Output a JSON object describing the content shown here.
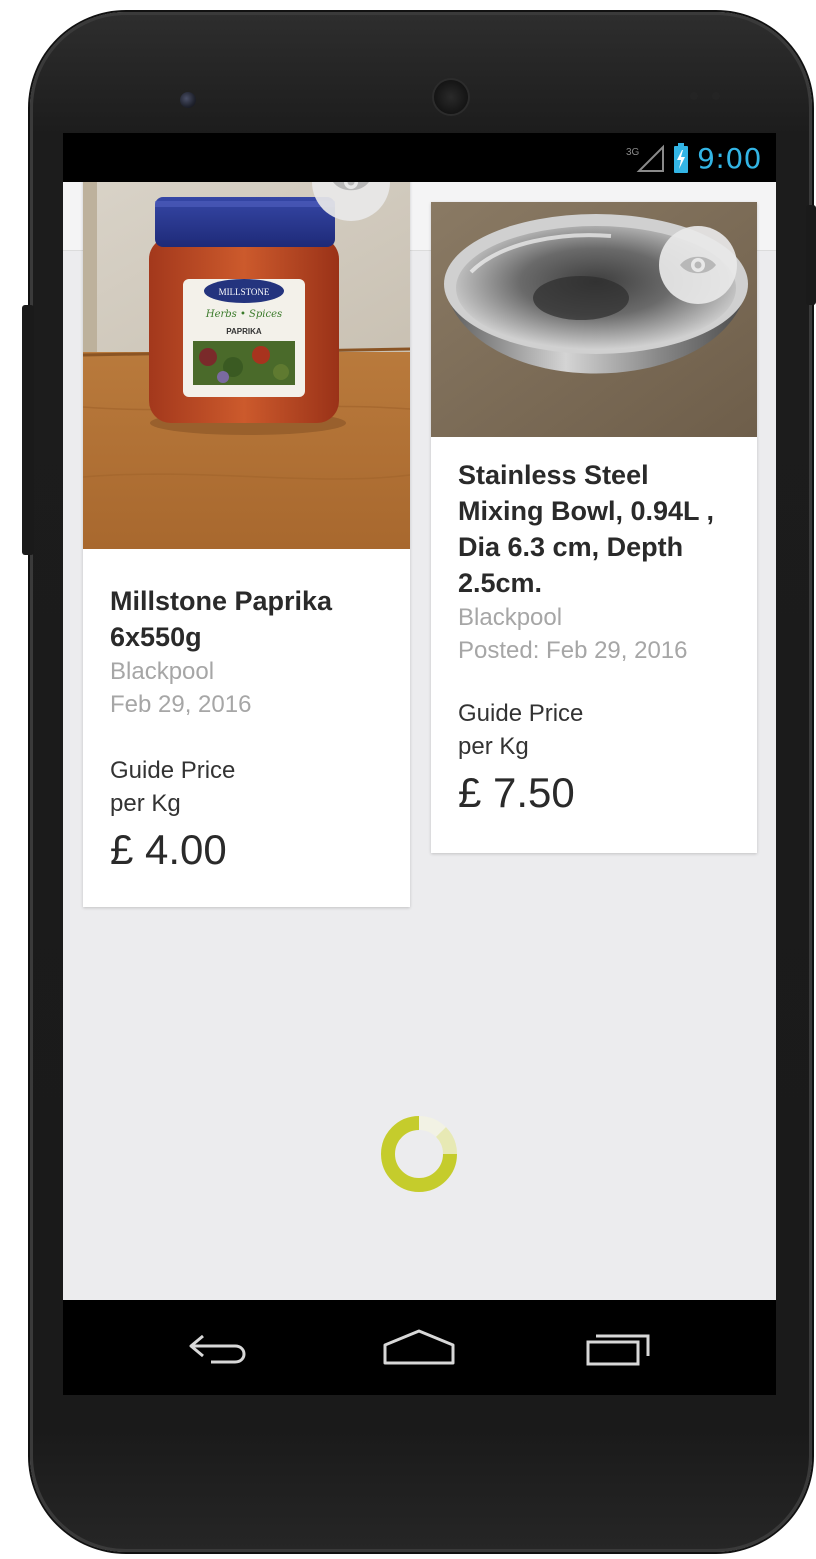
{
  "status_bar": {
    "network_label": "3G",
    "time": "9:00",
    "accent_color": "#33b5e5"
  },
  "listings": [
    {
      "title": "Millstone Paprika 6x550g",
      "location": "Blackpool",
      "date": "Feb 29, 2016",
      "guide_label_line1": "Guide Price",
      "guide_label_line2": "per Kg",
      "price": "£ 4.00",
      "image_label": "Paprika jar photo",
      "jar_brand": "MILLSTONE",
      "jar_subtitle": "Herbs • Spices",
      "jar_product": "PAPRIKA"
    },
    {
      "title": "Stainless Steel Mixing Bowl, 0.94L , Dia 6.3 cm, Depth 2.5cm.",
      "location": "Blackpool",
      "date": "Posted: Feb 29, 2016",
      "guide_label_line1": "Guide Price",
      "guide_label_line2": "per Kg",
      "price": "£ 7.50",
      "image_label": "Stainless steel bowl photo"
    }
  ],
  "spinner_color": "#c5cc2c",
  "icons": {
    "watch": "eye-icon",
    "back": "back-icon",
    "home": "home-icon",
    "recents": "recents-icon",
    "signal": "signal-icon",
    "battery": "battery-icon",
    "loading": "loading-spinner"
  }
}
